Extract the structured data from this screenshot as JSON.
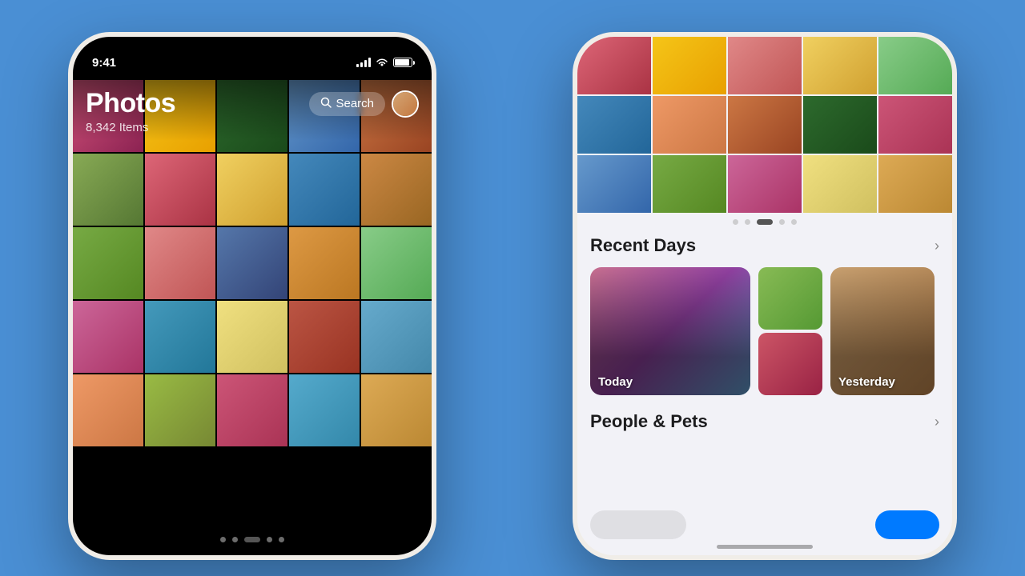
{
  "scene": {
    "bg_color": "#4a8fd4"
  },
  "phone_left": {
    "status": {
      "time": "9:41",
      "signal": "●●●●",
      "wifi": "wifi",
      "battery": "battery"
    },
    "header": {
      "title": "Photos",
      "item_count": "8,342 Items",
      "search_label": "Search"
    },
    "dots": [
      "dot",
      "dot",
      "active",
      "dot",
      "dot"
    ],
    "grid_colors": [
      "c1",
      "c2",
      "c3",
      "c4",
      "c5",
      "c6",
      "c7",
      "c8",
      "c9",
      "c10",
      "c11",
      "c12",
      "c13",
      "c14",
      "c15",
      "c16",
      "c17",
      "c18",
      "c19",
      "c20",
      "c21",
      "c22",
      "c23",
      "c24",
      "c25"
    ]
  },
  "phone_right": {
    "sections": {
      "recent_days": {
        "label": "Recent Days",
        "today_label": "Today",
        "yesterday_label": "Yesterday"
      },
      "people_pets": {
        "label": "People & Pets"
      }
    },
    "dots": [
      "dot",
      "dot",
      "active",
      "dot",
      "dot"
    ],
    "grid_colors": [
      "c4",
      "c7",
      "c12",
      "c3",
      "c15",
      "c9",
      "c21",
      "c18",
      "c5",
      "c23",
      "c11",
      "c16",
      "c2",
      "c25",
      "c8"
    ]
  }
}
